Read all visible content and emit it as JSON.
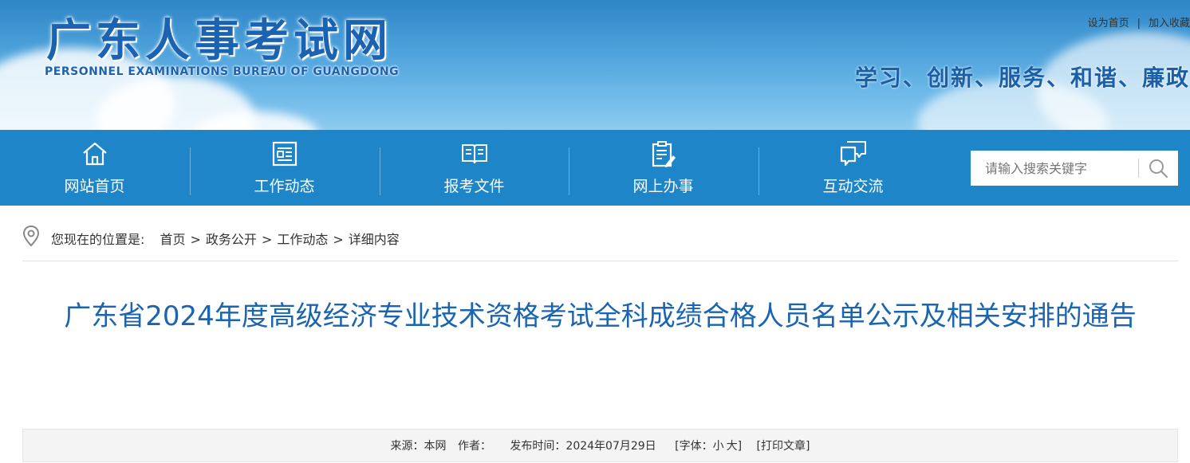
{
  "site": {
    "name_cn": "广东人事考试网",
    "name_en": "PERSONNEL EXAMINATIONS BUREAU OF GUANGDONG",
    "slogan": "学习、创新、服务、和谐、廉政"
  },
  "top_links": [
    {
      "label": "设为首页"
    },
    {
      "label": "加入收藏"
    }
  ],
  "top_links_sep": "|",
  "nav": [
    {
      "label": "网站首页",
      "icon": "home-icon"
    },
    {
      "label": "工作动态",
      "icon": "news-icon"
    },
    {
      "label": "报考文件",
      "icon": "book-icon"
    },
    {
      "label": "网上办事",
      "icon": "clipboard-pen-icon"
    },
    {
      "label": "互动交流",
      "icon": "chat-icon"
    }
  ],
  "search": {
    "placeholder": "请输入搜索关键字",
    "icon": "search-icon"
  },
  "breadcrumb": {
    "prefix": "您现在的位置是:",
    "items": [
      "首页",
      "政务公开",
      "工作动态",
      "详细内容"
    ],
    "sep": ">"
  },
  "article": {
    "title": "广东省2024年度高级经济专业技术资格考试全科成绩合格人员名单公示及相关安排的通告",
    "meta": {
      "source": "来源：本网",
      "author": "作者：",
      "published": "发布时间：2024年07月29日",
      "font_label": "[字体：",
      "font_small": "小",
      "font_large": "大]",
      "print": "[打印文章]"
    }
  },
  "colors": {
    "nav_bg": "#1d85c8",
    "title": "#1a64b0",
    "brand": "#1b62b0"
  }
}
